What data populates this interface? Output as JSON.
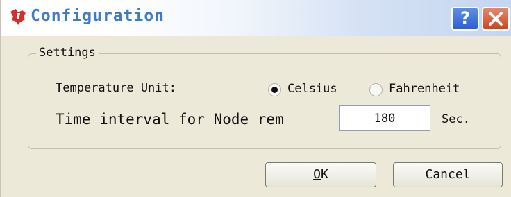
{
  "window": {
    "title": "Configuration",
    "help_label": "?"
  },
  "settings": {
    "group_label": "Settings",
    "temperature_label": "Temperature Unit:",
    "units": [
      {
        "label": "Celsius",
        "selected": true
      },
      {
        "label": "Fahrenheit",
        "selected": false
      }
    ],
    "interval_label": "Time interval for Node rem",
    "interval_value": "180",
    "interval_unit": "Sec."
  },
  "buttons": {
    "ok_mnemonic": "O",
    "ok_rest": "K",
    "cancel_label": "Cancel"
  },
  "colors": {
    "title_text": "#3f7cc4",
    "logo": "#d92d2d",
    "dialog_bg": "#ece9d8"
  },
  "icons": [
    "ti-logo-icon",
    "help-icon",
    "close-icon"
  ]
}
